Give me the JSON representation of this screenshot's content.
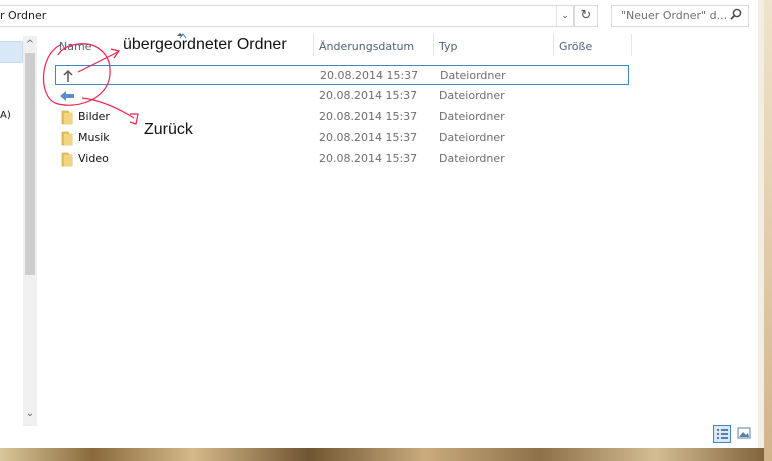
{
  "address": {
    "path_text": "r Ordner",
    "dropdown_icon": "chevron-down-icon"
  },
  "toolbar": {
    "refresh_icon": "refresh-icon"
  },
  "search": {
    "placeholder": "\"Neuer Ordner\" d...",
    "icon": "search-icon"
  },
  "nav": {
    "partial_text": "A)"
  },
  "columns": [
    "Name",
    "Änderungsdatum",
    "Typ",
    "Größe"
  ],
  "rows": [
    {
      "name": "",
      "date": "20.08.2014 15:37",
      "type": "Dateiordner",
      "icon": "arrow-up-icon",
      "selected": true
    },
    {
      "name": "",
      "date": "20.08.2014 15:37",
      "type": "Dateiordner",
      "icon": "arrow-left-icon",
      "selected": false
    },
    {
      "name": "Bilder",
      "date": "20.08.2014 15:37",
      "type": "Dateiordner",
      "icon": "folder-icon",
      "selected": false
    },
    {
      "name": "Musik",
      "date": "20.08.2014 15:37",
      "type": "Dateiordner",
      "icon": "folder-icon",
      "selected": false
    },
    {
      "name": "Video",
      "date": "20.08.2014 15:37",
      "type": "Dateiordner",
      "icon": "folder-icon",
      "selected": false
    }
  ],
  "annotations": {
    "parent": "übergeordneter Ordner",
    "back": "Zurück",
    "color": "#e8234f"
  },
  "view": {
    "details_icon": "details-view-icon",
    "tiles_icon": "preview-view-icon"
  },
  "colors": {
    "selection_border": "#3d86c9",
    "selection_fill": "#d9e8f7",
    "header_text": "#4c607a",
    "folder": "#e9c15a"
  }
}
